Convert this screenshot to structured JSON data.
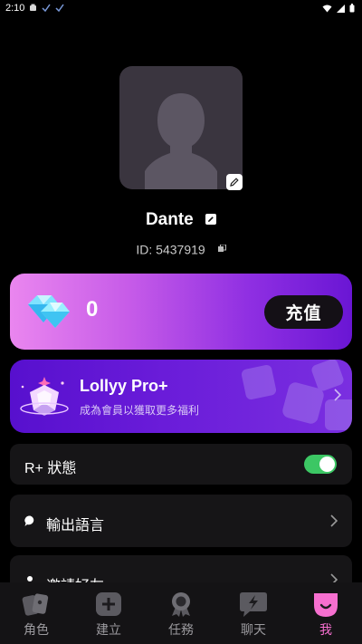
{
  "status_bar": {
    "time": "2:10"
  },
  "profile": {
    "name": "Dante",
    "id_text": "ID: 5437919"
  },
  "wallet": {
    "diamond_count": "0",
    "topup_label": "充值"
  },
  "pro_banner": {
    "title": "Lollyy Pro+",
    "subtitle": "成為會員以獲取更多福利"
  },
  "settings": {
    "rplus_label": "R+ 狀態",
    "rplus_enabled": true,
    "language_label": "輸出語言",
    "invite_label": "邀請好友"
  },
  "bottom_nav": {
    "items": [
      {
        "label": "角色",
        "icon": "cards-icon"
      },
      {
        "label": "建立",
        "icon": "add-icon"
      },
      {
        "label": "任務",
        "icon": "badge-icon"
      },
      {
        "label": "聊天",
        "icon": "chat-bolt-icon"
      },
      {
        "label": "我",
        "icon": "profile-icon",
        "active": true
      }
    ]
  },
  "colors": {
    "accent": "#f66fcf",
    "toggle_on": "#3cc764",
    "card_gradient_start": "#ea86ef",
    "card_gradient_end": "#6a16d4"
  }
}
